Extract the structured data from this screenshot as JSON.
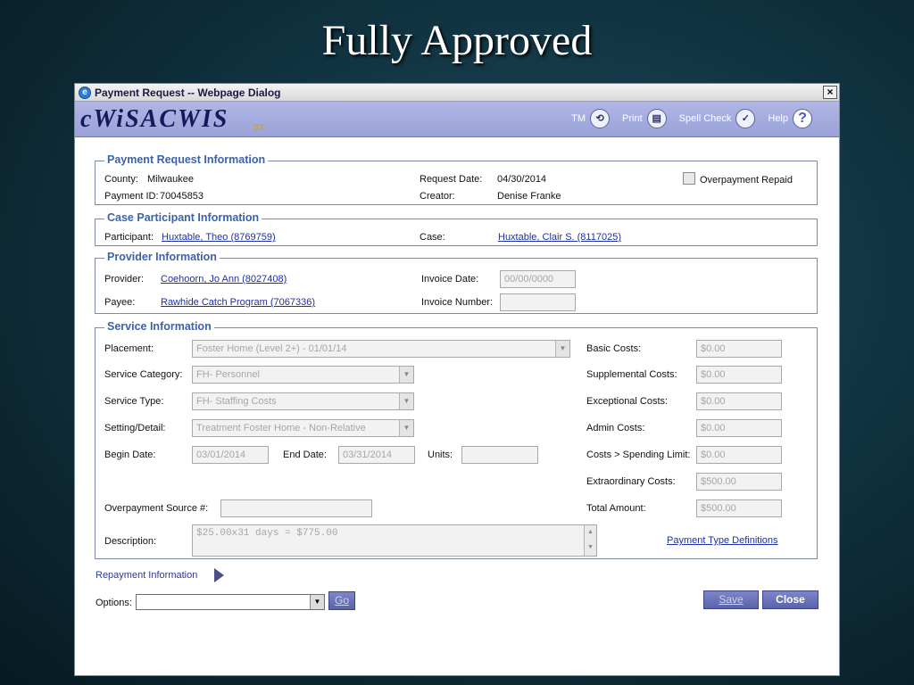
{
  "slide": {
    "title": "Fully Approved"
  },
  "window": {
    "title": "Payment Request -- Webpage Dialog",
    "close": "×"
  },
  "banner": {
    "logo": "cWiSACWIS",
    "logo_sub": "ST",
    "tools": {
      "tm": "TM",
      "print": "Print",
      "spell_check": "Spell Check",
      "help": "Help"
    }
  },
  "payment_request": {
    "legend": "Payment Request Information",
    "county_label": "County:",
    "county": "Milwaukee",
    "payment_id_label": "Payment ID:",
    "payment_id": "70045853",
    "request_date_label": "Request Date:",
    "request_date": "04/30/2014",
    "creator_label": "Creator:",
    "creator": "Denise Franke",
    "overpayment_repaid_label": "Overpayment Repaid"
  },
  "case_participant": {
    "legend": "Case Participant Information",
    "participant_label": "Participant:",
    "participant": "Huxtable, Theo (8769759)",
    "case_label": "Case:",
    "case": "Huxtable, Clair S. (8117025)"
  },
  "provider": {
    "legend": "Provider Information",
    "provider_label": "Provider:",
    "provider": "Coehoorn, Jo Ann (8027408)",
    "payee_label": "Payee:",
    "payee": "Rawhide Catch Program (7067336)",
    "invoice_date_label": "Invoice Date:",
    "invoice_date": "00/00/0000",
    "invoice_number_label": "Invoice Number:",
    "invoice_number": ""
  },
  "service": {
    "legend": "Service Information",
    "placement_label": "Placement:",
    "placement": "Foster Home (Level 2+) - 01/01/14",
    "category_label": "Service Category:",
    "category": "FH- Personnel",
    "type_label": "Service Type:",
    "type": "FH- Staffing Costs",
    "setting_label": "Setting/Detail:",
    "setting": "Treatment Foster Home - Non-Relative",
    "begin_label": "Begin Date:",
    "begin": "03/01/2014",
    "end_label": "End Date:",
    "end": "03/31/2014",
    "units_label": "Units:",
    "units": "",
    "overpayment_label": "Overpayment Source #:",
    "overpayment": "",
    "description_label": "Description:",
    "description": "$25.00x31 days = $775.00",
    "costs": {
      "basic_label": "Basic Costs:",
      "basic": "$0.00",
      "supplemental_label": "Supplemental Costs:",
      "supplemental": "$0.00",
      "exceptional_label": "Exceptional Costs:",
      "exceptional": "$0.00",
      "admin_label": "Admin Costs:",
      "admin": "$0.00",
      "spending_label": "Costs > Spending Limit:",
      "spending": "$0.00",
      "extraordinary_label": "Extraordinary Costs:",
      "extraordinary": "$500.00",
      "total_label": "Total Amount:",
      "total": "$500.00"
    },
    "payment_type_link": "Payment Type Definitions"
  },
  "repayment": {
    "label": "Repayment Information"
  },
  "options": {
    "label": "Options:",
    "value": "",
    "go": "Go"
  },
  "buttons": {
    "save": "Save",
    "close": "Close"
  }
}
